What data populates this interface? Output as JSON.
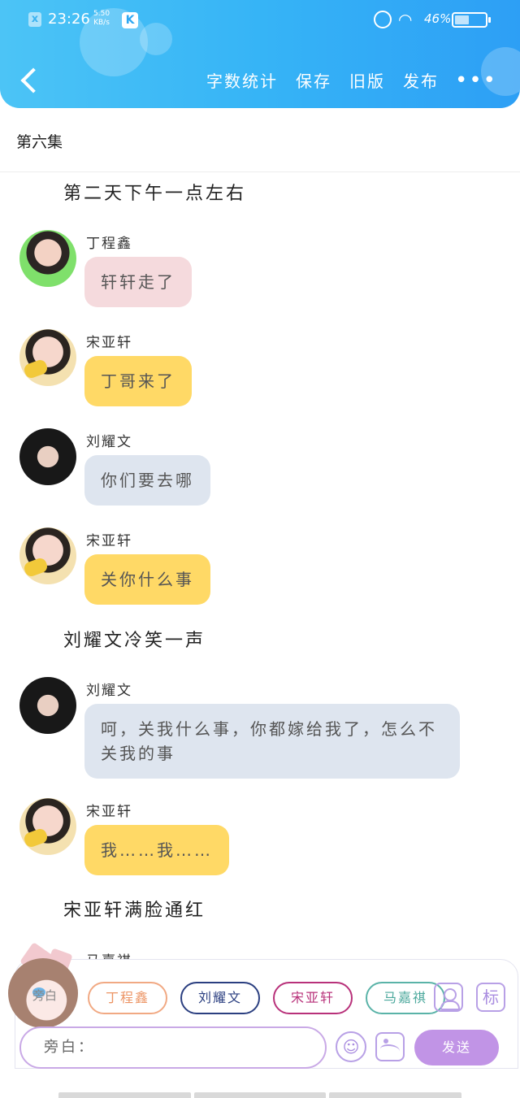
{
  "status_bar": {
    "time": "23:26",
    "net_speed_value": "5.50",
    "net_speed_unit": "KB/s",
    "k_app": "K",
    "battery_percent": "46%",
    "battery_level": 0.46,
    "icons": [
      "notification-x-icon",
      "k-app-icon",
      "alarm-icon",
      "wifi-icon",
      "battery-icon"
    ]
  },
  "header": {
    "actions": [
      "字数统计",
      "保存",
      "旧版",
      "发布"
    ],
    "more": "•••",
    "colors": {
      "gradient_start": "#4cc4f6",
      "gradient_end": "#2d9ff5"
    }
  },
  "episode_title": "第六集",
  "story": {
    "narration_1": "第二天下午一点左右",
    "narration_2": "刘耀文冷笑一声",
    "narration_3": "宋亚轩满脸通红",
    "messages": [
      {
        "sender": "丁程鑫",
        "text": "轩轩走了",
        "bubble_color": "#f5dadd"
      },
      {
        "sender": "宋亚轩",
        "text": "丁哥来了",
        "bubble_color": "#ffd966"
      },
      {
        "sender": "刘耀文",
        "text": "你们要去哪",
        "bubble_color": "#dee5ef"
      },
      {
        "sender": "宋亚轩",
        "text": "关你什么事",
        "bubble_color": "#ffd966"
      },
      {
        "sender": "刘耀文",
        "text": "呵，关我什么事，你都嫁给我了，怎么不关我的事",
        "bubble_color": "#dee5ef"
      },
      {
        "sender": "宋亚轩",
        "text": "我……我……",
        "bubble_color": "#ffd966"
      }
    ],
    "partial_sender": "马嘉祺"
  },
  "composer": {
    "narrator_chip": "旁白",
    "characters": [
      "丁程鑫",
      "刘耀文",
      "宋亚轩",
      "马嘉祺"
    ],
    "tag_label": "标",
    "input_placeholder": "旁白：",
    "send_label": "发送",
    "accent_color": "#c194e6"
  }
}
